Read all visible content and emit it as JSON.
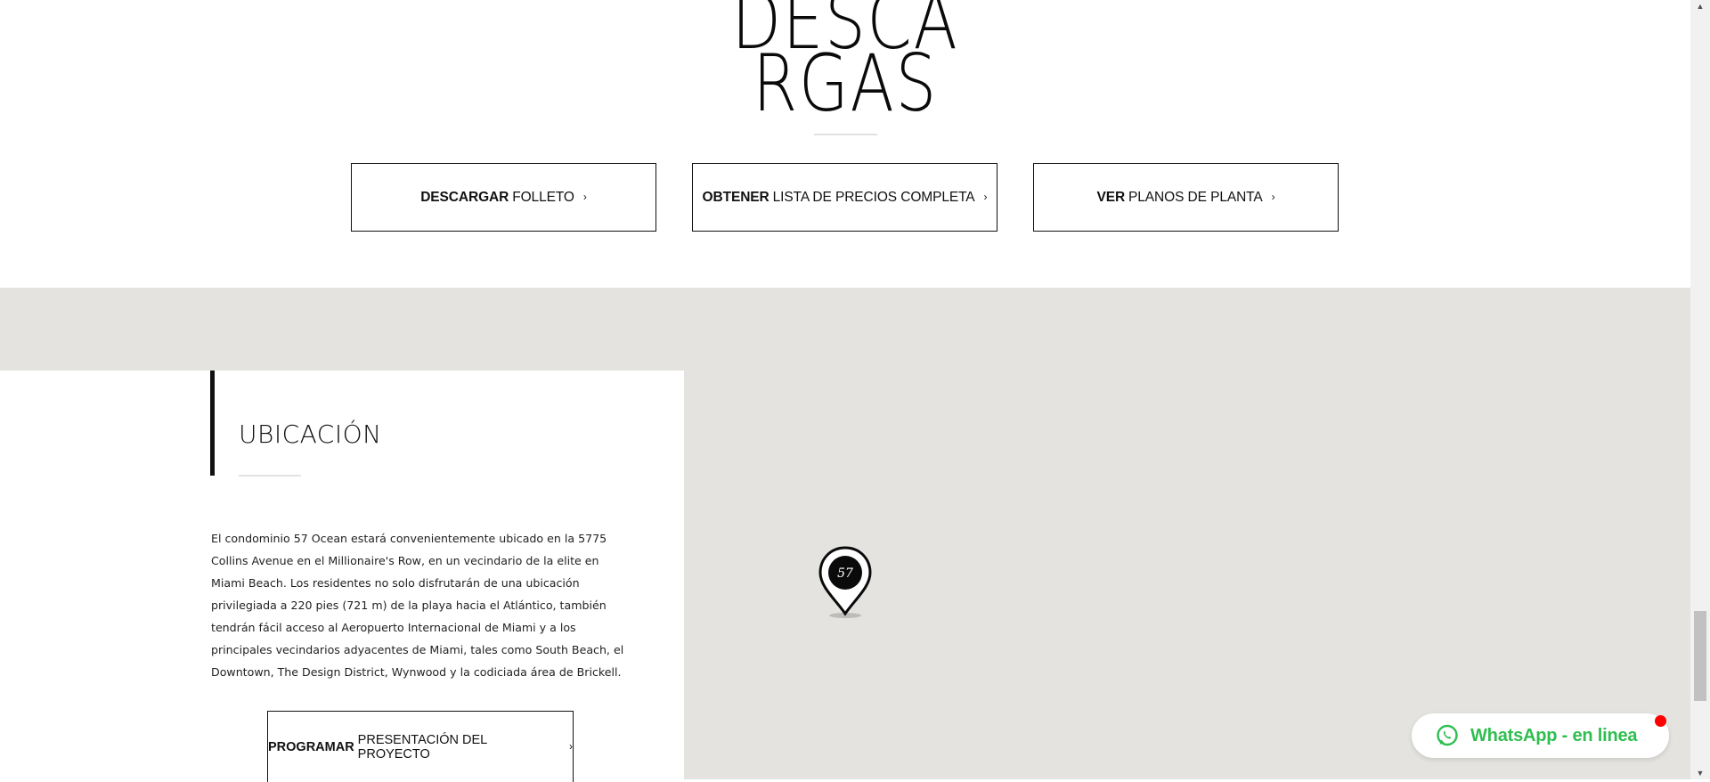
{
  "downloads": {
    "title_line1": "DESCA",
    "title_line2": "RGAS",
    "buttons": [
      {
        "bold": "DESCARGAR",
        "rest": "FOLLETO",
        "chevron": "›"
      },
      {
        "bold": "OBTENER",
        "rest": "LISTA DE PRECIOS COMPLETA",
        "chevron": "›"
      },
      {
        "bold": "VER",
        "rest": "PLANOS DE PLANTA",
        "chevron": "›"
      }
    ]
  },
  "location": {
    "title": "UBICACIÓN",
    "description": "El condominio 57 Ocean estará convenientemente ubicado en la 5775 Collins Avenue en el Millionaire's Row, en un vecindario de la elite en Miami Beach. Los residentes no solo disfrutarán de una ubicación privilegiada a 220 pies (721 m) de la playa hacia el Atlántico, también tendrán fácil acceso al Aeropuerto Internacional de Miami y a los principales vecindarios adyacentes de Miami, tales como South Beach, el Downtown, The Design District, Wynwood y la codiciada área de Brickell.",
    "button": {
      "bold": "PROGRAMAR",
      "rest": "PRESENTACIÓN DEL PROYECTO",
      "chevron": "›"
    },
    "map_pin_label": "57"
  },
  "whatsapp": {
    "label": "WhatsApp - en linea",
    "icon": "whatsapp-icon",
    "color": "#2fbe4f",
    "badge_color": "#ff0000"
  },
  "scrollbar": {
    "up": "▲",
    "down": "▼"
  }
}
